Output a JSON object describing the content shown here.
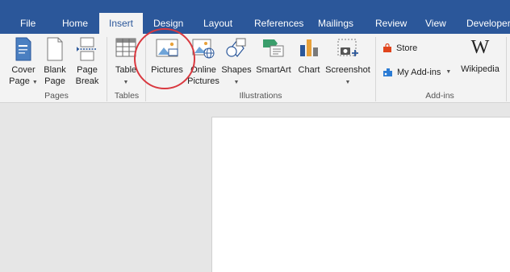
{
  "tabs": [
    {
      "label": "File"
    },
    {
      "label": "Home"
    },
    {
      "label": "Insert",
      "active": true
    },
    {
      "label": "Design"
    },
    {
      "label": "Layout"
    },
    {
      "label": "References"
    },
    {
      "label": "Mailings"
    },
    {
      "label": "Review"
    },
    {
      "label": "View"
    },
    {
      "label": "Developer"
    }
  ],
  "groups": {
    "pages": {
      "label": "Pages",
      "commands": [
        {
          "line1": "Cover",
          "line2": "Page",
          "icon": "cover-page-icon"
        },
        {
          "line1": "Blank",
          "line2": "Page",
          "icon": "blank-page-icon"
        },
        {
          "line1": "Page",
          "line2": "Break",
          "icon": "page-break-icon"
        }
      ]
    },
    "tables": {
      "label": "Tables",
      "commands": [
        {
          "line1": "Table",
          "icon": "table-icon"
        }
      ]
    },
    "illustrations": {
      "label": "Illustrations",
      "commands": [
        {
          "line1": "Pictures",
          "icon": "pictures-icon"
        },
        {
          "line1": "Online",
          "line2": "Pictures",
          "icon": "online-pictures-icon"
        },
        {
          "line1": "Shapes",
          "icon": "shapes-icon"
        },
        {
          "line1": "SmartArt",
          "icon": "smartart-icon"
        },
        {
          "line1": "Chart",
          "icon": "chart-icon"
        },
        {
          "line1": "Screenshot",
          "icon": "screenshot-icon"
        }
      ]
    },
    "addins": {
      "label": "Add-ins",
      "store": "Store",
      "my_addins": "My Add-ins",
      "wikipedia": "Wikipedia"
    }
  },
  "colors": {
    "accent": "#2b579a",
    "highlight": "#d9383f"
  }
}
